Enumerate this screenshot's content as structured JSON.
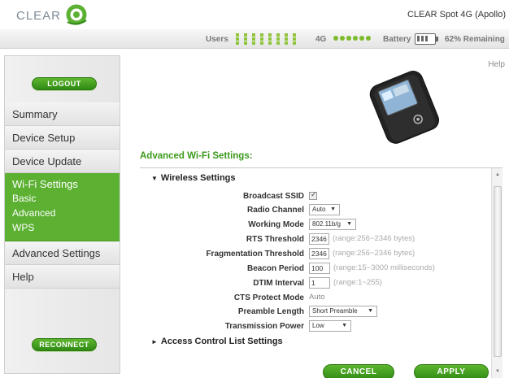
{
  "header": {
    "logo_text": "CLEAR",
    "device_title": "CLEAR Spot 4G (Apollo)"
  },
  "status": {
    "users_label": "Users",
    "network_label": "4G",
    "battery_label": "Battery",
    "battery_remaining": "62% Remaining",
    "signal_dots": 6
  },
  "sidebar": {
    "logout_label": "LOGOUT",
    "reconnect_label": "RECONNECT",
    "items": [
      {
        "label": "Summary"
      },
      {
        "label": "Device Setup"
      },
      {
        "label": "Device Update"
      },
      {
        "label": "Wi-Fi Settings",
        "active": true,
        "subitems": [
          "Basic",
          "Advanced",
          "WPS"
        ]
      },
      {
        "label": "Advanced Settings"
      },
      {
        "label": "Help"
      }
    ]
  },
  "main": {
    "help_label": "Help",
    "section_title": "Advanced Wi-Fi Settings:",
    "wireless_toggle": "Wireless Settings",
    "acl_toggle": "Access Control List Settings",
    "fields": {
      "broadcast_ssid": {
        "label": "Broadcast SSID",
        "checked": true
      },
      "radio_channel": {
        "label": "Radio Channel",
        "value": "Auto"
      },
      "working_mode": {
        "label": "Working Mode",
        "value": "802.11b/g"
      },
      "rts_threshold": {
        "label": "RTS Threshold",
        "value": "2346",
        "hint": "(range:256~2346 bytes)"
      },
      "frag_threshold": {
        "label": "Fragmentation Threshold",
        "value": "2346",
        "hint": "(range:256~2346 bytes)"
      },
      "beacon_period": {
        "label": "Beacon Period",
        "value": "100",
        "hint": "(range:15~3000 milliseconds)"
      },
      "dtim_interval": {
        "label": "DTIM Interval",
        "value": "1",
        "hint": "(range:1~255)"
      },
      "cts_protect": {
        "label": "CTS Protect Mode",
        "value": "Auto"
      },
      "preamble_length": {
        "label": "Preamble Length",
        "value": "Short Preamble"
      },
      "tx_power": {
        "label": "Transmission Power",
        "value": "Low"
      }
    },
    "cancel_label": "CANCEL",
    "apply_label": "APPLY"
  },
  "colors": {
    "brand_green": "#5cb032",
    "section_title": "#3b9a1b"
  }
}
